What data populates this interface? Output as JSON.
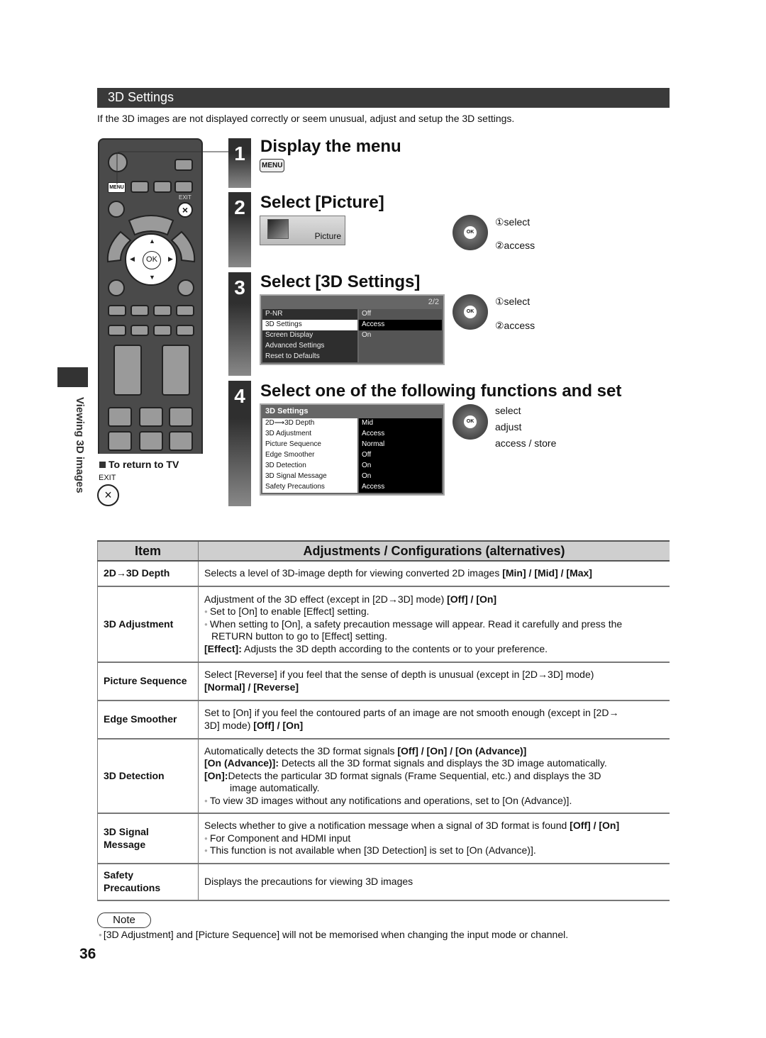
{
  "section": {
    "title": "3D Settings",
    "intro": "If the 3D images are not displayed correctly or seem unusual, adjust and setup the 3D settings."
  },
  "remote": {
    "menu_label": "MENU",
    "exit_label": "EXIT",
    "ok_label": "OK",
    "close_glyph": "×"
  },
  "sidebar": {
    "chapter": "Viewing 3D images"
  },
  "return_tv": {
    "title": "To return to TV",
    "exit_label": "EXIT",
    "close_glyph": "×"
  },
  "steps": [
    {
      "number": "1",
      "title": "Display the menu",
      "key": "MENU"
    },
    {
      "number": "2",
      "title": "Select [Picture]",
      "tile_label": "Picture",
      "nav": {
        "ok": "OK",
        "line1": "①select",
        "line2": "②access"
      }
    },
    {
      "number": "3",
      "title": "Select [3D Settings]",
      "osd": {
        "page": "2/2",
        "rows": [
          {
            "item": "P-NR",
            "value": "Off"
          },
          {
            "item": "3D Settings",
            "value": "Access"
          },
          {
            "item": "Screen Display",
            "value": "On"
          },
          {
            "item": "Advanced Settings",
            "value": ""
          },
          {
            "item": "Reset to Defaults",
            "value": ""
          }
        ]
      },
      "nav": {
        "ok": "OK",
        "line1": "①select",
        "line2": "②access"
      }
    },
    {
      "number": "4",
      "title": "Select one of the following functions and set",
      "osd": {
        "title": "3D Settings",
        "rows": [
          {
            "item": "2D⟶3D Depth",
            "value": "Mid"
          },
          {
            "item": "3D Adjustment",
            "value": "Access"
          },
          {
            "item": "Picture Sequence",
            "value": "Normal"
          },
          {
            "item": "Edge Smoother",
            "value": "Off"
          },
          {
            "item": "3D Detection",
            "value": "On"
          },
          {
            "item": "3D Signal Message",
            "value": "On"
          },
          {
            "item": "Safety Precautions",
            "value": "Access"
          }
        ]
      },
      "nav": {
        "ok": "OK",
        "line1": "select",
        "line2": "adjust",
        "line3": "access / store"
      }
    }
  ],
  "table": {
    "headers": [
      "Item",
      "Adjustments / Configurations (alternatives)"
    ],
    "rows": [
      {
        "item": "2D→3D Depth",
        "l1": "Selects a level of 3D-image depth for viewing converted 2D images ",
        "l1b": "[Min] / [Mid] / [Max]"
      },
      {
        "item": "3D Adjustment",
        "l1": "Adjustment of the 3D effect (except in [2D→3D] mode) ",
        "l1b": "[Off] / [On]",
        "b1": "Set to [On] to enable [Effect] setting.",
        "b2": "When setting to [On], a safety precaution message will appear. Read it carefully and press the",
        "b2c": "RETURN button to go to [Effect] setting.",
        "t1": "[Effect]:",
        "t2": " Adjusts the 3D depth according to the contents or to your preference."
      },
      {
        "item": "Picture Sequence",
        "l1": "Select [Reverse] if you feel that the sense of depth is unusual (except in [2D→3D] mode)",
        "l2b": "[Normal] / [Reverse]"
      },
      {
        "item": "Edge Smoother",
        "l1": "Set to [On] if you feel the contoured parts of an image are not smooth enough (except in [2D→",
        "l2": "3D] mode) ",
        "l2b": "[Off] / [On]"
      },
      {
        "item": "3D Detection",
        "l1": "Automatically detects the 3D format signals ",
        "l1b": "[Off] / [On] / [On (Advance)]",
        "a1": "[On (Advance)]:",
        "a2": " Detects all the 3D format signals and displays the 3D image automatically.",
        "o1": "[On]:",
        "o2": "Detects the particular 3D format signals (Frame Sequential, etc.) and displays the 3D",
        "o3": "image automatically.",
        "b1": "To view 3D images without any notifications and operations, set to [On (Advance)]."
      },
      {
        "item": "3D Signal Message",
        "l1": "Selects whether to give a notification message when a signal of 3D format is found ",
        "l1b": "[Off] / [On]",
        "b1": "For Component and HDMI input",
        "b2": "This function is not available when [3D Detection] is set to [On (Advance)]."
      },
      {
        "item": "Safety Precautions",
        "l1": "Displays the precautions for viewing 3D images"
      }
    ]
  },
  "note": {
    "label": "Note",
    "text": "[3D Adjustment] and [Picture Sequence] will not be memorised when changing the input mode or channel."
  },
  "page_number": "36",
  "colors": {
    "bar": "#3a3a3a",
    "table_header": "#cfcfcf",
    "osd_bg": "#666666"
  }
}
